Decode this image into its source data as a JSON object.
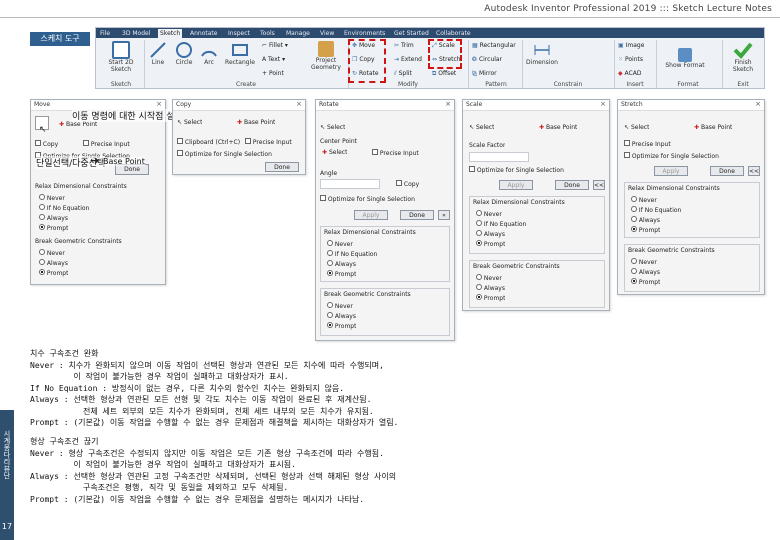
{
  "header": {
    "title": "Autodesk Inventor Professional 2019 ::: Sketch Lecture Notes"
  },
  "tag": {
    "label": "스케치 도구"
  },
  "sidebar": {
    "vertical_text": "시계몽다리뷰단",
    "page": "17"
  },
  "ribbon": {
    "tabs": [
      "File",
      "3D Model",
      "Sketch",
      "Annotate",
      "Inspect",
      "Tools",
      "Manage",
      "View",
      "Environments",
      "Get Started",
      "Collaborate"
    ],
    "active_tab": "Sketch",
    "buttons": {
      "start_sketch": "Start 2D Sketch",
      "line": "Line",
      "circle": "Circle",
      "arc": "Arc",
      "rectangle": "Rectangle",
      "fillet": "Fillet",
      "text": "Text",
      "point": "Point",
      "project_geometry": "Project Geometry",
      "move": "Move",
      "copy": "Copy",
      "rotate": "Rotate",
      "trim": "Trim",
      "extend": "Extend",
      "split": "Split",
      "scale": "Scale",
      "stretch": "Stretch",
      "offset": "Offset",
      "rect_pattern": "Rectangular",
      "circular": "Circular",
      "mirror": "Mirror",
      "dimension": "Dimension",
      "image": "Image",
      "points": "Points",
      "acad": "ACAD",
      "show_format": "Show Format",
      "finish_sketch": "Finish Sketch"
    },
    "groups": {
      "sketch": "Sketch",
      "create": "Create",
      "modify": "Modify",
      "pattern": "Pattern",
      "constrain": "Constrain",
      "insert": "Insert",
      "format": "Format",
      "exit": "Exit"
    }
  },
  "annotations": {
    "base_point_setting": "이동 명령에 대한 시작점 설정",
    "single_multi_select": "단일선택/다중선택",
    "base_point": "Base Point"
  },
  "dialogs": {
    "move": {
      "title": "Move",
      "base_point": "Base Point",
      "copy": "Copy",
      "precise_input": "Precise Input",
      "optimize": "Optimize for Single Selection",
      "done": "Done",
      "relax_title": "Relax Dimensional Constraints",
      "relax_opts": [
        "Never",
        "If No Equation",
        "Always",
        "Prompt"
      ],
      "break_title": "Break Geometric Constraints",
      "break_opts": [
        "Never",
        "Always",
        "Prompt"
      ]
    },
    "copy": {
      "title": "Copy",
      "select": "Select",
      "base_point": "Base Point",
      "clipboard": "Clipboard (Ctrl+C)",
      "precise_input": "Precise Input",
      "optimize": "Optimize for Single Selection",
      "done": "Done"
    },
    "rotate": {
      "title": "Rotate",
      "select": "Select",
      "center_point": "Center Point",
      "precise_input": "Precise Input",
      "angle": "Angle",
      "angle_value": "",
      "copy": "Copy",
      "optimize": "Optimize for Single Selection",
      "apply": "Apply",
      "done": "Done",
      "relax_title": "Relax Dimensional Constraints",
      "relax_opts": [
        "Never",
        "If No Equation",
        "Always",
        "Prompt"
      ],
      "break_title": "Break Geometric Constraints",
      "break_opts": [
        "Never",
        "Always",
        "Prompt"
      ]
    },
    "scale": {
      "title": "Scale",
      "select": "Select",
      "base_point": "Base Point",
      "scale_factor": "Scale Factor",
      "scale_value": "",
      "optimize": "Optimize for Single Selection",
      "apply": "Apply",
      "done": "Done",
      "more": "<<",
      "relax_title": "Relax Dimensional Constraints",
      "relax_opts": [
        "Never",
        "If No Equation",
        "Always",
        "Prompt"
      ],
      "break_title": "Break Geometric Constraints",
      "break_opts": [
        "Never",
        "Always",
        "Prompt"
      ]
    },
    "stretch": {
      "title": "Stretch",
      "select": "Select",
      "base_point": "Base Point",
      "precise_input": "Precise Input",
      "optimize": "Optimize for Single Selection",
      "apply": "Apply",
      "done": "Done",
      "more": "<<",
      "relax_title": "Relax Dimensional Constraints",
      "relax_opts": [
        "Never",
        "If No Equation",
        "Always",
        "Prompt"
      ],
      "break_title": "Break Geometric Constraints",
      "break_opts": [
        "Never",
        "Always",
        "Prompt"
      ]
    }
  },
  "notes": {
    "relax": [
      "치수 구속조건 완화",
      "Never : 치수가 완화되지 않으며 이동 작업이 선택된 형상과 연관된 모든 치수에 따라 수행되며,",
      "         이 작업이 불가능한 경우 작업이 실패하고 대화상자가 표시.",
      "If No Equation : 방정식이 없는 경우, 다른 치수의 함수인 치수는 완화되지 않음.",
      "Always : 선택한 형상과 연관된 모든 선형 및 각도 치수는 이동 작업이 완료된 후 재계산됨.",
      "           전체 세트 외부의 모든 치수가 완화되며, 전체 세트 내부의 모든 치수가 유지됨.",
      "Prompt : (기본값) 이동 작업을 수행할 수 없는 경우 문제점과 해결책을 제시하는 대화상자가 열림."
    ],
    "break": [
      "형상 구속조건 끊기",
      "Never : 형상 구속조건은 수정되지 않지만 이동 작업은 모든 기존 형상 구속조건에 따라 수행됨.",
      "         이 작업이 불가능한 경우 작업이 실패하고 대화상자가 표시됨.",
      "Always : 선택한 형상과 연관된 고정 구속조건만 삭제되며, 선택된 형상과 선택 해제된 형상 사이의",
      "           구속조건은 평행, 직각 및 동일을 제외하고 모두 삭제됨.",
      "Prompt : (기본값) 이동 작업을 수행할 수 없는 경우 문제점을 설명하는 메시지가 나타남."
    ]
  },
  "colors": {
    "accent": "#d01414",
    "sidebar": "#2f4f6f",
    "ribbon_bar": "#2d4b6f"
  }
}
